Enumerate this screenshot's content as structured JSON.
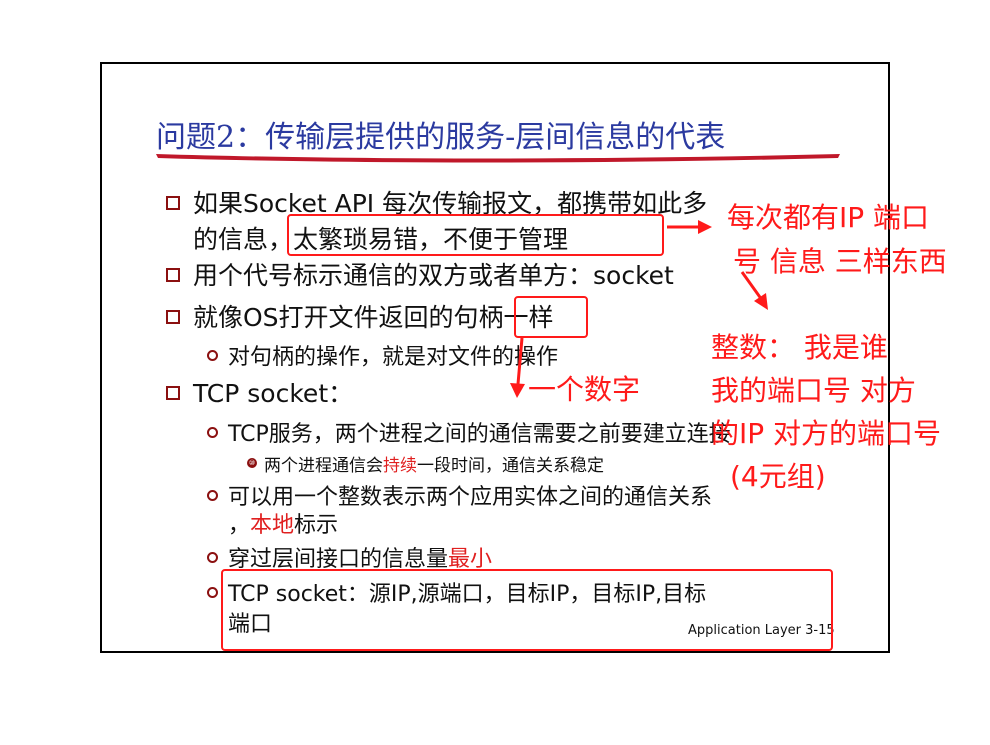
{
  "slide": {
    "title": "问题2：传输层提供的服务-层间信息的代表",
    "bullets": [
      {
        "l1": "如果Socket API 每次传输报文，都携带如此多",
        "l2": "的信息，太繁琐易错，不便于管理"
      },
      {
        "text": "用个代号标示通信的双方或者单方：socket"
      },
      {
        "text": "就像OS打开文件返回的句柄一样"
      },
      {
        "sub": "对句柄的操作，就是对文件的操作"
      },
      {
        "text": "TCP socket："
      }
    ],
    "tcp_items": {
      "item1": "TCP服务，两个进程之间的通信需要之前要建立连接",
      "item1_sub_a": "两个进程通信会",
      "item1_sub_red": "持续",
      "item1_sub_b": "一段时间，通信关系稳定",
      "item2_l1": "可以用一个整数表示两个应用实体之间的通信关系",
      "item2_l2_a": "，",
      "item2_l2_red": "本地",
      "item2_l2_b": "标示",
      "item3_a": "穿过层间接口的信息量",
      "item3_red": "最小",
      "item4_l1": "TCP socket：源IP,源端口，目标IP，目标IP,目标",
      "item4_l2": "端口"
    },
    "footer": "Application Layer  3-15"
  },
  "annotations": {
    "a1_l1": "每次都有IP 端口",
    "a1_l2": "号 信息 三样东西",
    "a2": "一个数字",
    "a3_l1": "整数：  我是谁",
    "a3_l2": "我的端口号 对方",
    "a3_l3": "的IP 对方的端口号",
    "a3_l4": "(4元组)"
  },
  "colors": {
    "title": "#2b3aa0",
    "bullet": "#8b1010",
    "annotation": "#ff1a1a",
    "highlight": "#e02020"
  }
}
